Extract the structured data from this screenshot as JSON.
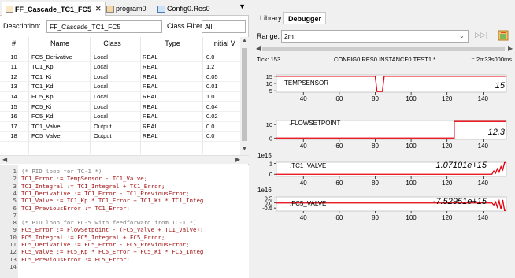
{
  "editor": {
    "tabs": [
      {
        "label": "FF_Cascade_TC1_FC5",
        "icon": "function-block-icon",
        "active": true
      },
      {
        "label": "program0",
        "icon": "program-icon",
        "active": false
      },
      {
        "label": "Config0.Res0",
        "icon": "config-icon",
        "active": false
      }
    ],
    "tab_close": "✕",
    "tab_menu": "▼",
    "description_label": "Description:",
    "description_value": "FF_Cascade_TC1_FC5",
    "class_filter_label": "Class Filter:",
    "class_filter_value": "All",
    "columns": [
      "#",
      "Name",
      "Class",
      "Type",
      "Initial V"
    ],
    "rows": [
      [
        "10",
        "FC5_Derivative",
        "Local",
        "REAL",
        "0.0"
      ],
      [
        "11",
        "TC1_Kp",
        "Local",
        "REAL",
        "1.2"
      ],
      [
        "12",
        "TC1_Ki",
        "Local",
        "REAL",
        "0.05"
      ],
      [
        "13",
        "TC1_Kd",
        "Local",
        "REAL",
        "0.01"
      ],
      [
        "14",
        "FC5_Kp",
        "Local",
        "REAL",
        "1.0"
      ],
      [
        "15",
        "FC5_Ki",
        "Local",
        "REAL",
        "0.04"
      ],
      [
        "16",
        "FC5_Kd",
        "Local",
        "REAL",
        "0.02"
      ],
      [
        "17",
        "TC1_Valve",
        "Output",
        "REAL",
        "0.0"
      ],
      [
        "18",
        "FC5_Valve",
        "Output",
        "REAL",
        "0.0"
      ]
    ],
    "code_lines": [
      {
        "n": "1",
        "text": "(* PID loop for TC-1 *)",
        "comment": true
      },
      {
        "n": "2",
        "text": "TC1_Error := TempSensor - TC1_Valve;",
        "comment": false
      },
      {
        "n": "3",
        "text": "TC1_Integral := TC1_Integral + TC1_Error;",
        "comment": false
      },
      {
        "n": "4",
        "text": "TC1_Derivative := TC1_Error - TC1_PreviousError;",
        "comment": false
      },
      {
        "n": "5",
        "text": "TC1_Valve := TC1_Kp * TC1_Error + TC1_Ki * TC1_Integ",
        "comment": false
      },
      {
        "n": "6",
        "text": "TC1_PreviousError := TC1_Error;",
        "comment": false
      },
      {
        "n": "7",
        "text": "",
        "comment": false
      },
      {
        "n": "8",
        "text": "(* PID loop for FC-5 with feedforward from TC-1 *)",
        "comment": true
      },
      {
        "n": "9",
        "text": "FC5_Error := FlowSetpoint - (FC5_Valve + TC1_Valve);",
        "comment": false
      },
      {
        "n": "10",
        "text": "FC5_Integral := FC5_Integral + FC5_Error;",
        "comment": false
      },
      {
        "n": "11",
        "text": "FC5_Derivative := FC5_Error - FC5_PreviousError;",
        "comment": false
      },
      {
        "n": "12",
        "text": "FC5_Valve := FC5_Kp * FC5_Error + FC5_Ki * FC5_Integ",
        "comment": false
      },
      {
        "n": "13",
        "text": "FC5_PreviousError := FC5_Error;",
        "comment": false
      },
      {
        "n": "14",
        "text": "",
        "comment": false
      }
    ]
  },
  "debugger": {
    "tabs": [
      "Library",
      "Debugger"
    ],
    "active_tab": "Debugger",
    "range_label": "Range:",
    "range_value": "2m",
    "tick_label": "Tick: 153",
    "instance_path": "CONFIG0.RES0.INSTANCE0.TEST1.*",
    "time_label": "t: 2m33s000ms",
    "colors": {
      "trace": "#e8000b",
      "accent": "#d96e00"
    }
  },
  "chart_data": [
    {
      "type": "line",
      "title": "TEMPSENSOR",
      "current_value": "15",
      "xlim": [
        25,
        153
      ],
      "x_ticks": [
        40,
        60,
        80,
        100,
        120,
        140
      ],
      "ylim": [
        4,
        16
      ],
      "y_ticks": [
        "15",
        "10",
        "5"
      ],
      "y_tick_values": [
        15,
        10,
        5
      ],
      "series": [
        {
          "x": [
            25,
            80,
            81,
            84,
            85,
            153
          ],
          "y": [
            15,
            15,
            4.5,
            4.5,
            15,
            15
          ]
        }
      ]
    },
    {
      "type": "line",
      "title": ".FLOWSETPOINT",
      "current_value": "12.3",
      "xlim": [
        25,
        153
      ],
      "x_ticks": [
        40,
        60,
        80,
        100,
        120,
        140
      ],
      "ylim": [
        -1,
        13
      ],
      "y_ticks": [
        "10",
        "0"
      ],
      "y_tick_values": [
        10,
        0
      ],
      "series": [
        {
          "x": [
            25,
            124,
            124,
            153
          ],
          "y": [
            0,
            0,
            12.3,
            12.3
          ]
        }
      ]
    },
    {
      "type": "line",
      "title": ".TC1_VALVE",
      "current_value": "1.07101e+15",
      "scale_label": "1e15",
      "xlim": [
        25,
        153
      ],
      "x_ticks": [
        40,
        60,
        80,
        100,
        120,
        140
      ],
      "ylim": [
        -0.2,
        1.1
      ],
      "y_ticks": [
        "1",
        "0"
      ],
      "y_tick_values": [
        1,
        0
      ],
      "series": [
        {
          "x": [
            25,
            145,
            146,
            147,
            148,
            149,
            150,
            151,
            152,
            153
          ],
          "y": [
            0,
            0,
            0.3,
            0.1,
            0.5,
            0.2,
            0.7,
            0.4,
            1.07,
            1.07
          ]
        }
      ]
    },
    {
      "type": "line",
      "title": ".FC5_VALVE",
      "current_value": "-7.52951e+15",
      "scale_label": "1e16",
      "xlim": [
        25,
        153
      ],
      "x_ticks": [
        40,
        60,
        80,
        100,
        120,
        140
      ],
      "ylim": [
        -0.8,
        0.6
      ],
      "y_ticks": [
        "0.5",
        "0.0",
        "-0.5"
      ],
      "y_tick_values": [
        0.5,
        0,
        -0.5
      ],
      "series": [
        {
          "x": [
            25,
            145,
            146,
            147,
            148,
            149,
            150,
            151,
            152,
            153
          ],
          "y": [
            0,
            0,
            -0.2,
            0.1,
            -0.4,
            0.2,
            -0.6,
            0.3,
            -0.75,
            -0.75
          ]
        }
      ]
    }
  ]
}
